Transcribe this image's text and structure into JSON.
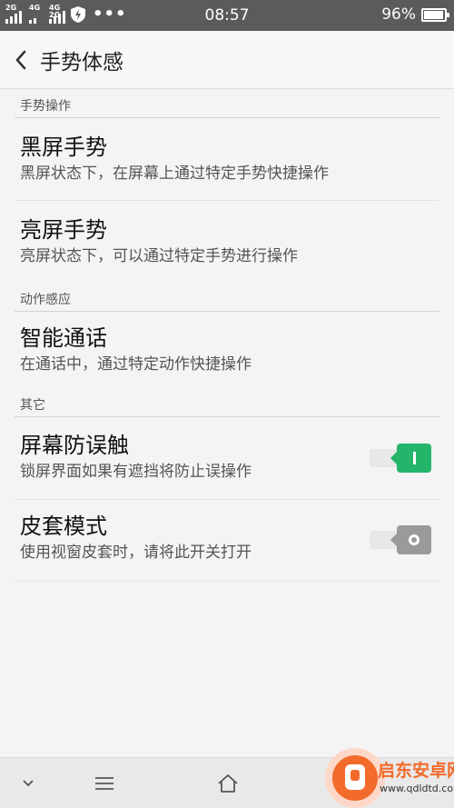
{
  "status_bar": {
    "signal_1_tag": "2G",
    "signal_2_tag": "4G",
    "signal_3_tag": "4G 2G",
    "time": "08:57",
    "battery": "96%"
  },
  "header": {
    "title": "手势体感"
  },
  "sections": [
    {
      "header": "手势操作",
      "items": [
        {
          "title": "黑屏手势",
          "subtitle": "黑屏状态下，在屏幕上通过特定手势快捷操作"
        },
        {
          "title": "亮屏手势",
          "subtitle": "亮屏状态下，可以通过特定手势进行操作"
        }
      ]
    },
    {
      "header": "动作感应",
      "items": [
        {
          "title": "智能通话",
          "subtitle": "在通话中，通过特定动作快捷操作"
        }
      ]
    },
    {
      "header": "其它",
      "items": [
        {
          "title": "屏幕防误触",
          "subtitle": "锁屏界面如果有遮挡将防止误操作",
          "toggle": "on"
        },
        {
          "title": "皮套模式",
          "subtitle": "使用视窗皮套时，请将此开关打开",
          "toggle": "off"
        }
      ]
    }
  ],
  "colors": {
    "toggle_on": "#24b56a",
    "toggle_off": "#9a9a9a",
    "status_bar": "#5b5b5b"
  },
  "icons": {
    "back": "chevron-left-icon",
    "nav_hide": "chevron-down-icon",
    "nav_menu": "menu-icon",
    "nav_home": "home-icon"
  },
  "watermark": {
    "name": "启东安卓网",
    "url": "www.qdldtd.com"
  }
}
